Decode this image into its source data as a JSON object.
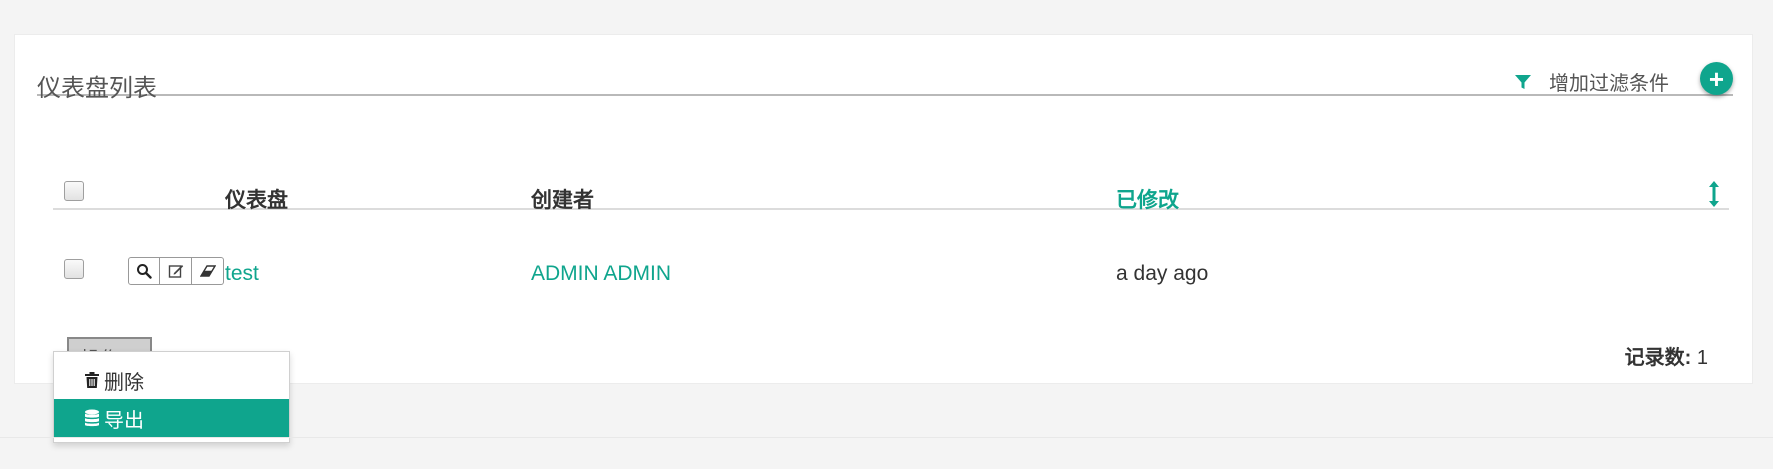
{
  "panel": {
    "title": "仪表盘列表",
    "filter_label": "增加过滤条件",
    "filter_icon": "funnel-icon",
    "add_icon": "plus-circle-icon",
    "add_symbol": "+"
  },
  "table": {
    "columns": [
      "仪表盘",
      "创建者",
      "已修改"
    ],
    "sorted_column": "已修改",
    "rows": [
      {
        "name": "test",
        "creator": "ADMIN ADMIN",
        "modified": "a day ago",
        "actions": [
          "search-icon",
          "edit-icon",
          "eraser-icon"
        ]
      }
    ]
  },
  "footer": {
    "ops_label": "操作",
    "record_label": "记录数:",
    "record_value": "1"
  },
  "dropdown": {
    "items": [
      {
        "label": "删除",
        "icon": "trash-icon"
      },
      {
        "label": "导出",
        "icon": "database-icon",
        "active": true
      }
    ]
  },
  "colors": {
    "accent": "#0fa58d",
    "background": "#f4f4f4",
    "panel": "#ffffff"
  }
}
